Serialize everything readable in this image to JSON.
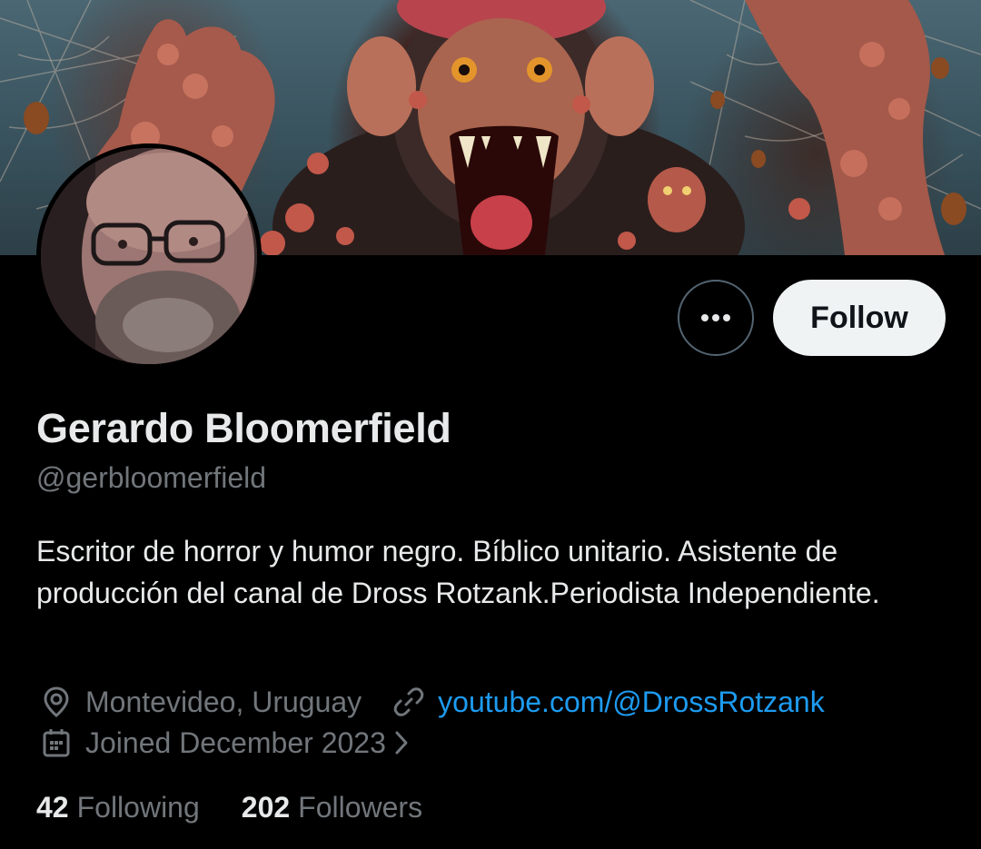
{
  "profile": {
    "display_name": "Gerardo Bloomerfield",
    "handle": "@gerbloomerfield",
    "bio": "Escritor de horror y humor negro. Bíblico unitario. Asistente de producción del canal de Dross Rotzank.Periodista Independiente.",
    "location": "Montevideo, Uruguay",
    "website": "youtube.com/@DrossRotzank",
    "joined": "Joined December 2023"
  },
  "actions": {
    "follow_label": "Follow",
    "more_icon": "more-horizontal-icon"
  },
  "stats": {
    "following_count": "42",
    "following_label": "Following",
    "followers_count": "202",
    "followers_label": "Followers"
  },
  "icons": {
    "location": "location-pin-icon",
    "link": "link-icon",
    "calendar": "calendar-icon",
    "chevron": "chevron-right-icon"
  },
  "colors": {
    "background": "#000000",
    "primary_text": "#e7e9ea",
    "secondary_text": "#71767b",
    "link": "#1d9bf0",
    "follow_button_bg": "#eff3f4",
    "follow_button_text": "#0f1419"
  }
}
